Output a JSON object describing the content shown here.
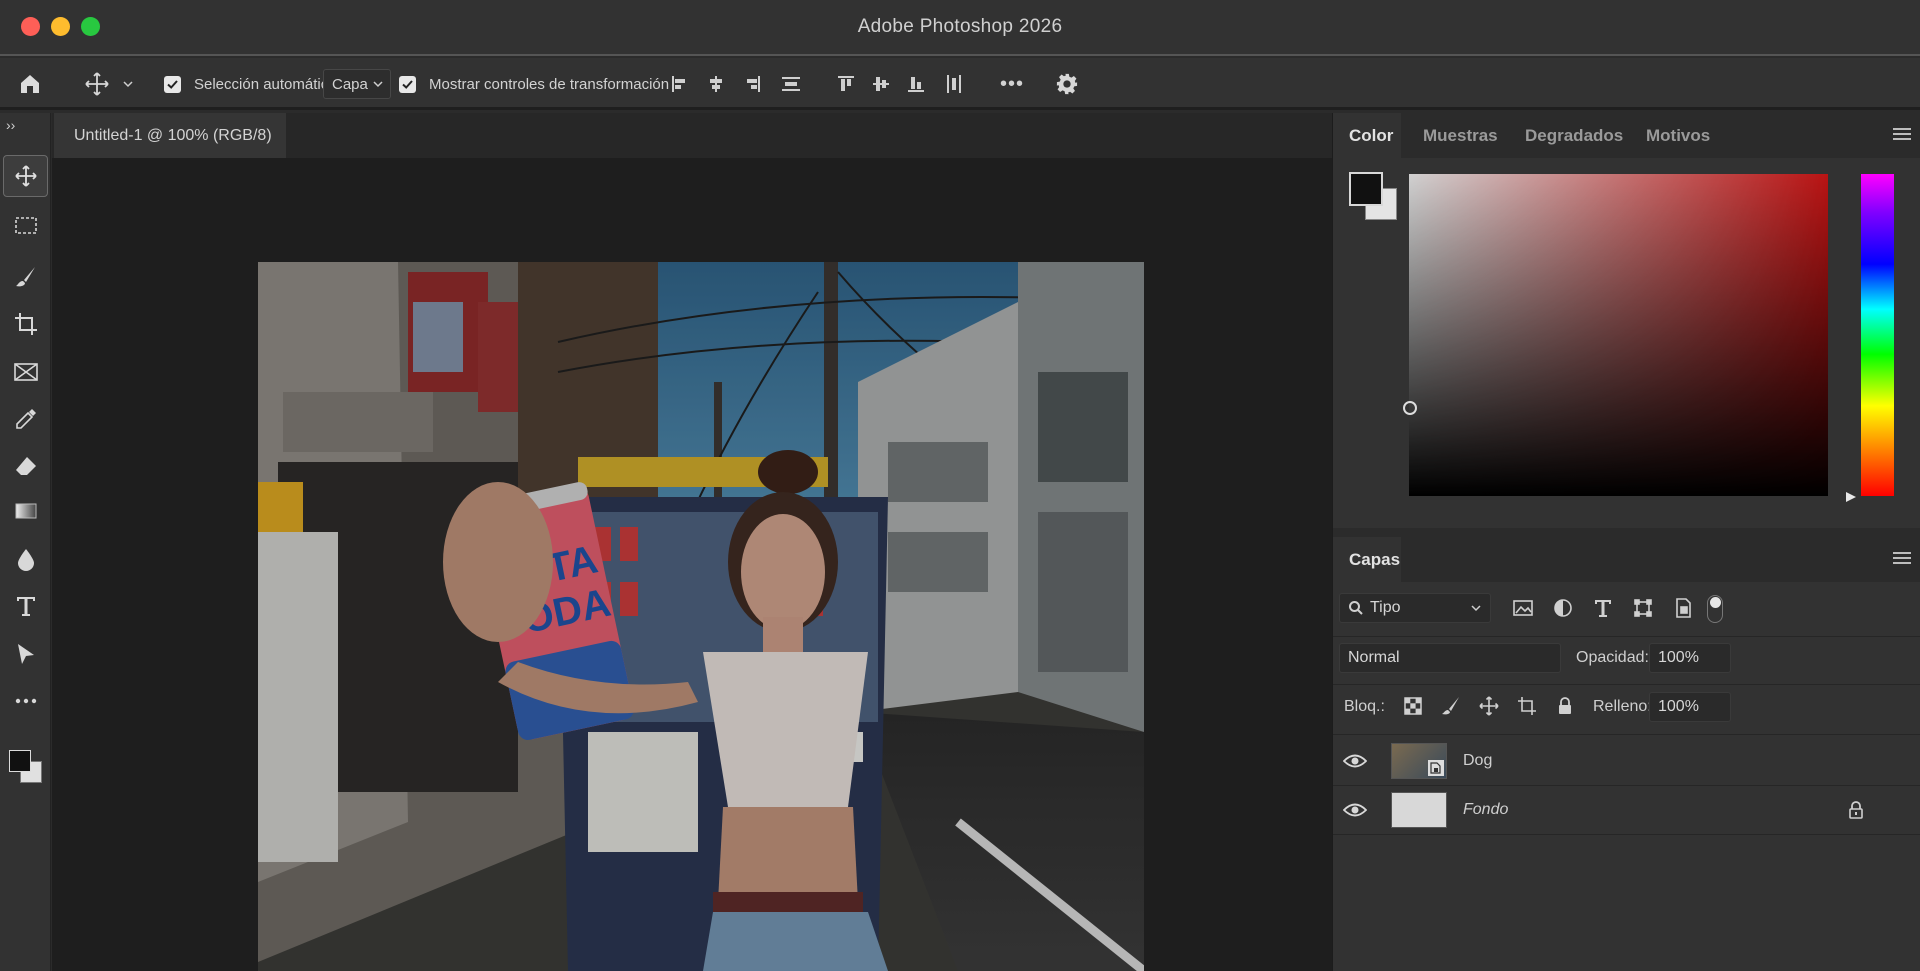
{
  "window": {
    "title": "Adobe Photoshop 2026"
  },
  "options_bar": {
    "auto_select_label": "Selección automática:",
    "auto_select_target": "Capa",
    "show_transform_label": "Mostrar controles de transformación",
    "more_label": "•••"
  },
  "document": {
    "tab_title": "Untitled-1 @ 100% (RGB/8)"
  },
  "color_panel": {
    "tabs": [
      {
        "label": "Color",
        "active": true
      },
      {
        "label": "Muestras",
        "active": false
      },
      {
        "label": "Degradados",
        "active": false
      },
      {
        "label": "Motivos",
        "active": false
      }
    ],
    "foreground": "#111111",
    "background": "#e4e4e4"
  },
  "layers_panel": {
    "tab_label": "Capas",
    "filter_label": "Tipo",
    "blend_mode": "Normal",
    "opacity_label": "Opacidad:",
    "opacity_value": "100%",
    "lock_label": "Bloq.:",
    "fill_label": "Relleno:",
    "fill_value": "100%",
    "layers": [
      {
        "name": "Dog",
        "visible": true,
        "locked": false,
        "italic": false
      },
      {
        "name": "Fondo",
        "visible": true,
        "locked": true,
        "italic": true
      }
    ]
  },
  "photo_text": {
    "can_line1": "SOTA",
    "can_line2": "SODA"
  }
}
